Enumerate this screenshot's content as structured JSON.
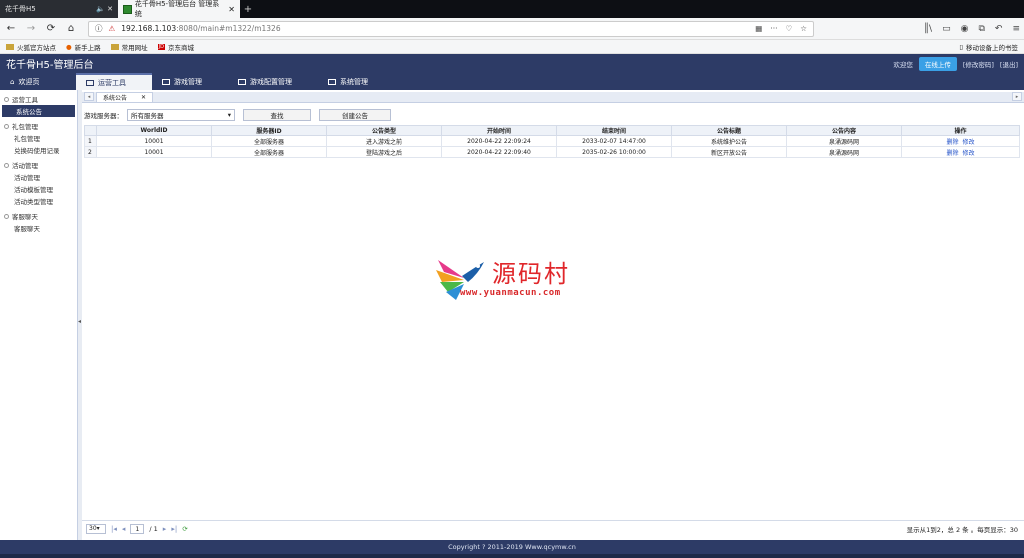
{
  "browser": {
    "tabs": [
      {
        "title": "花千骨H5"
      },
      {
        "title": "花千骨H5-管理后台 管理系统"
      }
    ],
    "url": {
      "host": "192.168.1.103",
      "rest": ":8080/main#m1322/m1326"
    },
    "bookmarks": [
      "火狐官方站点",
      "新手上路",
      "常用网址",
      "京东商城"
    ],
    "mobile_bookmarks": "移动设备上的书签"
  },
  "app": {
    "title": "花千骨H5-管理后台",
    "welcome": "欢迎您",
    "online_badge": "在线上传",
    "links": "[修改密码]",
    "logout": "[退出]"
  },
  "menu": [
    {
      "label": "欢迎页"
    },
    {
      "label": "运营工具"
    },
    {
      "label": "游戏管理"
    },
    {
      "label": "游戏配置管理"
    },
    {
      "label": "系统管理"
    }
  ],
  "sidebar": {
    "groups": [
      {
        "label": "运营工具",
        "items": [
          "系统公告"
        ]
      },
      {
        "label": "礼包管理",
        "items": [
          "礼包管理",
          "兑换码使用记录"
        ]
      },
      {
        "label": "活动管理",
        "items": [
          "活动管理",
          "活动模板管理",
          "活动类型管理"
        ]
      },
      {
        "label": "客服聊天",
        "items": [
          "客服聊天"
        ]
      }
    ]
  },
  "subtab": {
    "label": "系统公告"
  },
  "toolbar": {
    "server_label": "游戏服务器：",
    "server_value": "所有服务器",
    "search_btn": "查找",
    "create_btn": "创建公告"
  },
  "table": {
    "headers": [
      "",
      "WorldID",
      "服务器ID",
      "公告类型",
      "开始时间",
      "结束时间",
      "公告标题",
      "公告内容",
      "操作"
    ],
    "rows": [
      [
        "1",
        "10001",
        "全部服务器",
        "进入游戏之前",
        "2020-04-22 22:09:24",
        "2033-02-07 14:47:00",
        "系统维护公告",
        "泉涌源码网"
      ],
      [
        "2",
        "10001",
        "全部服务器",
        "登陆游戏之后",
        "2020-04-22 22:09:40",
        "2035-02-26 10:00:00",
        "新区开放公告",
        "泉涌源码网"
      ]
    ],
    "actions": {
      "delete": "删除",
      "edit": "修改"
    }
  },
  "watermark": {
    "title": "源码村",
    "url": "www.yuanmacun.com"
  },
  "pager": {
    "page_size": "30",
    "page": "1",
    "total_pages": "/ 1",
    "info": "显示从1到2，总 2 条 。每页显示：30"
  },
  "footer": "Copyright ? 2011-2019 Www.qcymw.cn"
}
